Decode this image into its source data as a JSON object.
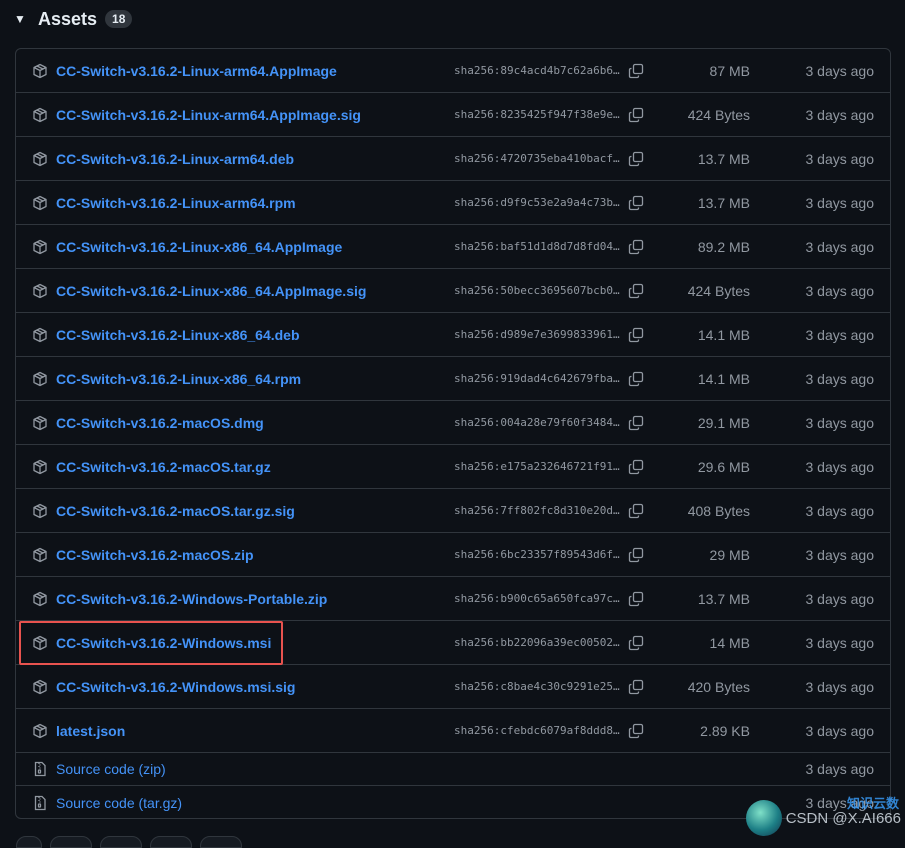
{
  "section": {
    "title": "Assets",
    "count": "18"
  },
  "assets": [
    {
      "name": "CC-Switch-v3.16.2-Linux-arm64.AppImage",
      "sha": "sha256:89c4acd4b7c62a6b6…",
      "size": "87 MB",
      "date": "3 days ago"
    },
    {
      "name": "CC-Switch-v3.16.2-Linux-arm64.AppImage.sig",
      "sha": "sha256:8235425f947f38e9e…",
      "size": "424 Bytes",
      "date": "3 days ago"
    },
    {
      "name": "CC-Switch-v3.16.2-Linux-arm64.deb",
      "sha": "sha256:4720735eba410bacf…",
      "size": "13.7 MB",
      "date": "3 days ago"
    },
    {
      "name": "CC-Switch-v3.16.2-Linux-arm64.rpm",
      "sha": "sha256:d9f9c53e2a9a4c73b…",
      "size": "13.7 MB",
      "date": "3 days ago"
    },
    {
      "name": "CC-Switch-v3.16.2-Linux-x86_64.AppImage",
      "sha": "sha256:baf51d1d8d7d8fd04…",
      "size": "89.2 MB",
      "date": "3 days ago"
    },
    {
      "name": "CC-Switch-v3.16.2-Linux-x86_64.AppImage.sig",
      "sha": "sha256:50becc3695607bcb0…",
      "size": "424 Bytes",
      "date": "3 days ago"
    },
    {
      "name": "CC-Switch-v3.16.2-Linux-x86_64.deb",
      "sha": "sha256:d989e7e3699833961…",
      "size": "14.1 MB",
      "date": "3 days ago"
    },
    {
      "name": "CC-Switch-v3.16.2-Linux-x86_64.rpm",
      "sha": "sha256:919dad4c642679fba…",
      "size": "14.1 MB",
      "date": "3 days ago"
    },
    {
      "name": "CC-Switch-v3.16.2-macOS.dmg",
      "sha": "sha256:004a28e79f60f3484…",
      "size": "29.1 MB",
      "date": "3 days ago"
    },
    {
      "name": "CC-Switch-v3.16.2-macOS.tar.gz",
      "sha": "sha256:e175a232646721f91…",
      "size": "29.6 MB",
      "date": "3 days ago"
    },
    {
      "name": "CC-Switch-v3.16.2-macOS.tar.gz.sig",
      "sha": "sha256:7ff802fc8d310e20d…",
      "size": "408 Bytes",
      "date": "3 days ago"
    },
    {
      "name": "CC-Switch-v3.16.2-macOS.zip",
      "sha": "sha256:6bc23357f89543d6f…",
      "size": "29 MB",
      "date": "3 days ago"
    },
    {
      "name": "CC-Switch-v3.16.2-Windows-Portable.zip",
      "sha": "sha256:b900c65a650fca97c…",
      "size": "13.7 MB",
      "date": "3 days ago"
    },
    {
      "name": "CC-Switch-v3.16.2-Windows.msi",
      "sha": "sha256:bb22096a39ec00502…",
      "size": "14 MB",
      "date": "3 days ago"
    },
    {
      "name": "CC-Switch-v3.16.2-Windows.msi.sig",
      "sha": "sha256:c8bae4c30c9291e25…",
      "size": "420 Bytes",
      "date": "3 days ago"
    },
    {
      "name": "latest.json",
      "sha": "sha256:cfebdc6079af8ddd8…",
      "size": "2.89 KB",
      "date": "3 days ago"
    }
  ],
  "sources": [
    {
      "label": "Source code",
      "format": "(zip)",
      "date": "3 days ago"
    },
    {
      "label": "Source code",
      "format": "(tar.gz)",
      "date": "3 days ago"
    }
  ],
  "icons": {
    "caret": "triangle-down-icon",
    "package": "package-icon",
    "copy": "copy-icon",
    "zip": "file-zip-icon"
  },
  "colors": {
    "background": "#0d1117",
    "link": "#4493f8",
    "muted": "#9198a1",
    "border": "#30363d",
    "highlight": "#e8534f"
  },
  "watermark": {
    "text": "CSDN @X.AI666",
    "brand": "知识云数"
  }
}
